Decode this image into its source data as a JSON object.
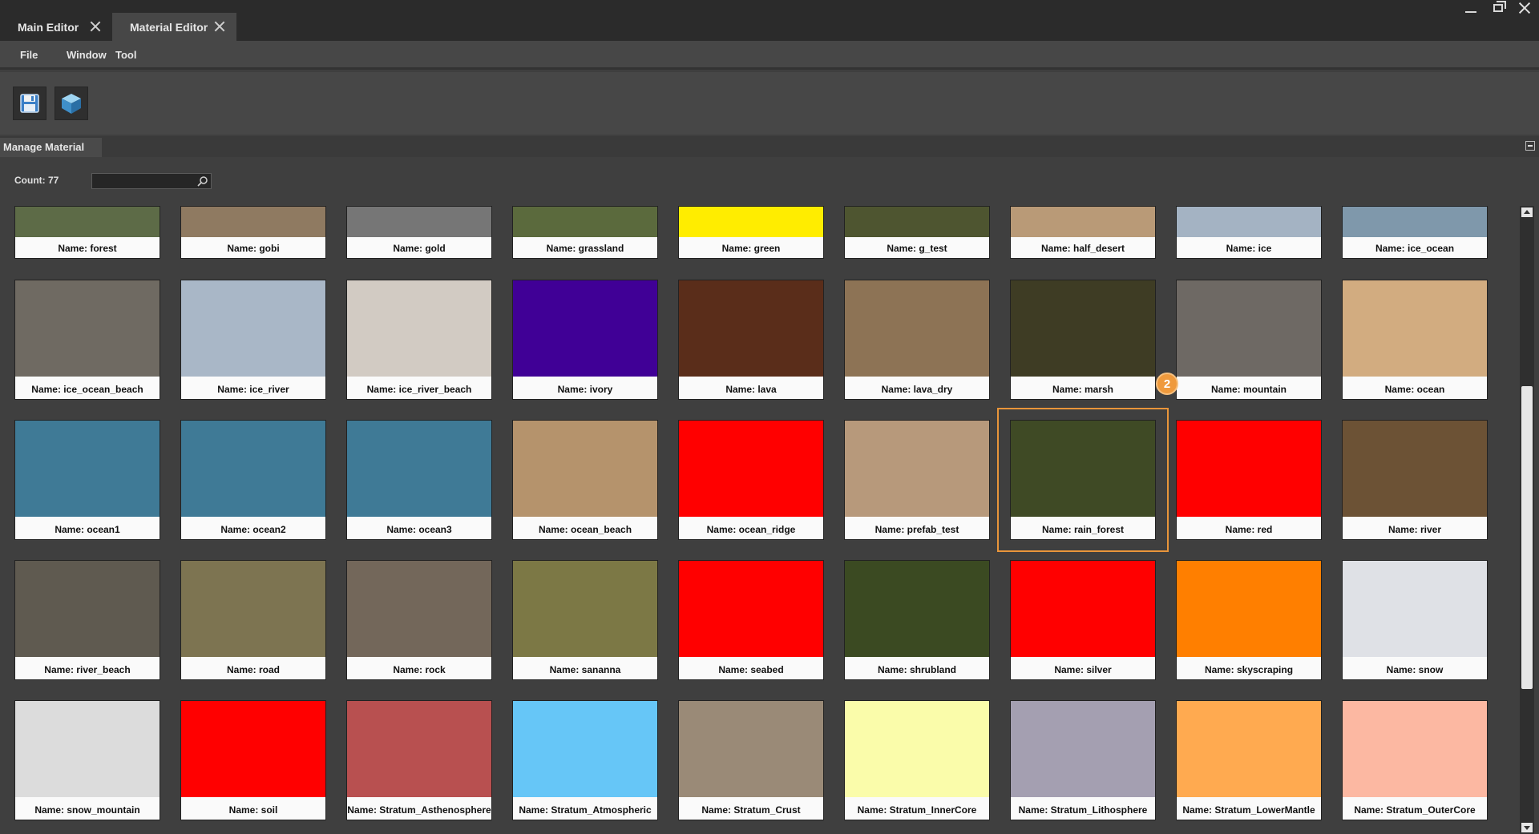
{
  "tabs": [
    {
      "label": "Main Editor"
    },
    {
      "label": "Material Editor"
    }
  ],
  "menu": {
    "file": "File",
    "window": "Window",
    "tool": "Tool"
  },
  "toolbar": {
    "save_icon": "save-icon",
    "cube_icon": "cube-icon"
  },
  "panel": {
    "title": "Manage Material"
  },
  "count": {
    "label": "Count: 77"
  },
  "search": {
    "placeholder": ""
  },
  "badge": "2",
  "materials": [
    {
      "name": "Name: forest",
      "color": "#5d6b47"
    },
    {
      "name": "Name: gobi",
      "color": "#8f7a61"
    },
    {
      "name": "Name: gold",
      "color": "#767676"
    },
    {
      "name": "Name: grassland",
      "color": "#5b6a3d"
    },
    {
      "name": "Name: green",
      "color": "#ffed00"
    },
    {
      "name": "Name: g_test",
      "color": "#4e5530"
    },
    {
      "name": "Name: half_desert",
      "color": "#b99a77"
    },
    {
      "name": "Name: ice",
      "color": "#a4b3c3"
    },
    {
      "name": "Name: ice_ocean",
      "color": "#7f98ab"
    },
    {
      "name": "Name: ice_ocean_beach",
      "color": "#6f6a62"
    },
    {
      "name": "Name: ice_river",
      "color": "#a9b7c7"
    },
    {
      "name": "Name: ice_river_beach",
      "color": "#d2cbc3"
    },
    {
      "name": "Name: ivory",
      "color": "#400096"
    },
    {
      "name": "Name: lava",
      "color": "#5a2d1a"
    },
    {
      "name": "Name: lava_dry",
      "color": "#8d7355"
    },
    {
      "name": "Name: marsh",
      "color": "#3e3c24"
    },
    {
      "name": "Name: mountain",
      "color": "#6e6964"
    },
    {
      "name": "Name: ocean",
      "color": "#d2ac80"
    },
    {
      "name": "Name: ocean1",
      "color": "#3f7a96"
    },
    {
      "name": "Name: ocean2",
      "color": "#3f7a96"
    },
    {
      "name": "Name: ocean3",
      "color": "#3f7a96"
    },
    {
      "name": "Name: ocean_beach",
      "color": "#b5936c"
    },
    {
      "name": "Name: ocean_ridge",
      "color": "#ff0000"
    },
    {
      "name": "Name: prefab_test",
      "color": "#b7997b"
    },
    {
      "name": "Name: rain_forest",
      "color": "#3f4a25"
    },
    {
      "name": "Name: red",
      "color": "#ff0000"
    },
    {
      "name": "Name: river",
      "color": "#6c5235"
    },
    {
      "name": "Name: river_beach",
      "color": "#5f5a50"
    },
    {
      "name": "Name: road",
      "color": "#7d7451"
    },
    {
      "name": "Name: rock",
      "color": "#73675a"
    },
    {
      "name": "Name: sananna",
      "color": "#7c7845"
    },
    {
      "name": "Name: seabed",
      "color": "#ff0000"
    },
    {
      "name": "Name: shrubland",
      "color": "#3b4a22"
    },
    {
      "name": "Name: silver",
      "color": "#ff0000"
    },
    {
      "name": "Name: skyscraping",
      "color": "#ff7f00"
    },
    {
      "name": "Name: snow",
      "color": "#dfe1e6"
    },
    {
      "name": "Name: snow_mountain",
      "color": "#dcdcdc"
    },
    {
      "name": "Name: soil",
      "color": "#ff0000"
    },
    {
      "name": "Name: Stratum_Asthenosphere",
      "color": "#b85050"
    },
    {
      "name": "Name: Stratum_Atmospheric",
      "color": "#66c6f7"
    },
    {
      "name": "Name: Stratum_Crust",
      "color": "#9a8a77"
    },
    {
      "name": "Name: Stratum_InnerCore",
      "color": "#fafcaa"
    },
    {
      "name": "Name: Stratum_Lithosphere",
      "color": "#a49fb1"
    },
    {
      "name": "Name: Stratum_LowerMantle",
      "color": "#ffaa50"
    },
    {
      "name": "Name: Stratum_OuterCore",
      "color": "#fcb8a2"
    }
  ],
  "selected": "Name: rain_forest"
}
